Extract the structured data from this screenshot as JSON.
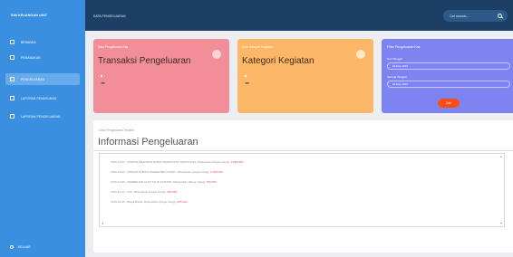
{
  "sidebar": {
    "brand": "SIM KEUANGAN UNIT",
    "items": [
      {
        "label": "BERANDA",
        "active": false
      },
      {
        "label": "PEMASUKAN",
        "active": false
      },
      {
        "label": "PENGELUARAN",
        "active": true
      },
      {
        "label": "LAPORAN PEMASUKAN",
        "active": false
      },
      {
        "label": "LAPORAN PENGELUARAN",
        "active": false
      }
    ],
    "logout": "KELUAR"
  },
  "topbar": {
    "title": "DATA PENGELUARAN",
    "search_placeholder": "Cari sesuatu..."
  },
  "cards": {
    "pink": {
      "small": "Data Pengeluaran Kas",
      "title": "Transaksi Pengeluaran",
      "value": "-"
    },
    "orange": {
      "small": "Data Kategori Kegiatan",
      "title": "Kategori Kegiatan",
      "value": "-"
    }
  },
  "filter": {
    "title": "Filter Pengeluaran Kas",
    "from_label": "Dari Tanggal",
    "from_value": "01 Des 2019",
    "to_label": "Sampai Tanggal",
    "to_value": "31 Des 2019",
    "button": "Cari"
  },
  "panel": {
    "small": "Data Pengeluaran Terakhir",
    "title": "Informasi Pengeluaran",
    "lines": [
      {
        "date": "2019-12-01",
        "text": "HONOR KEGIATAN RAPAT KERJA UNIT TAHUN 2019. Dibayarkan (bayar Uang):",
        "amount": "1.250.000"
      },
      {
        "date": "2019-12-04",
        "text": "HONOR PANITIA SEMESTER GANJIL. Dibayarkan (bayar Uang):",
        "amount": "1.400.000"
      },
      {
        "date": "2019-12-09",
        "text": "PEMBELIAN ALAT TULIS KANTOR. Dibayarkan (bayar Uang):",
        "amount": "750.000"
      },
      {
        "date": "2019-12-12",
        "text": "ATK. Dibayarkan (bayar Uang):",
        "amount": "300.000"
      },
      {
        "date": "2019-12-15",
        "text": "Biaya Rapat. Dibayarkan (bayar Uang):",
        "amount": "225.000"
      }
    ]
  },
  "colors": {
    "sidebar": "#3b8fe0",
    "topbar": "#1d3f66",
    "card_pink": "#f18e97",
    "card_orange": "#fdb768",
    "card_purple": "#7d83f1",
    "button": "#ff4d1a",
    "amount": "#e8484a"
  }
}
